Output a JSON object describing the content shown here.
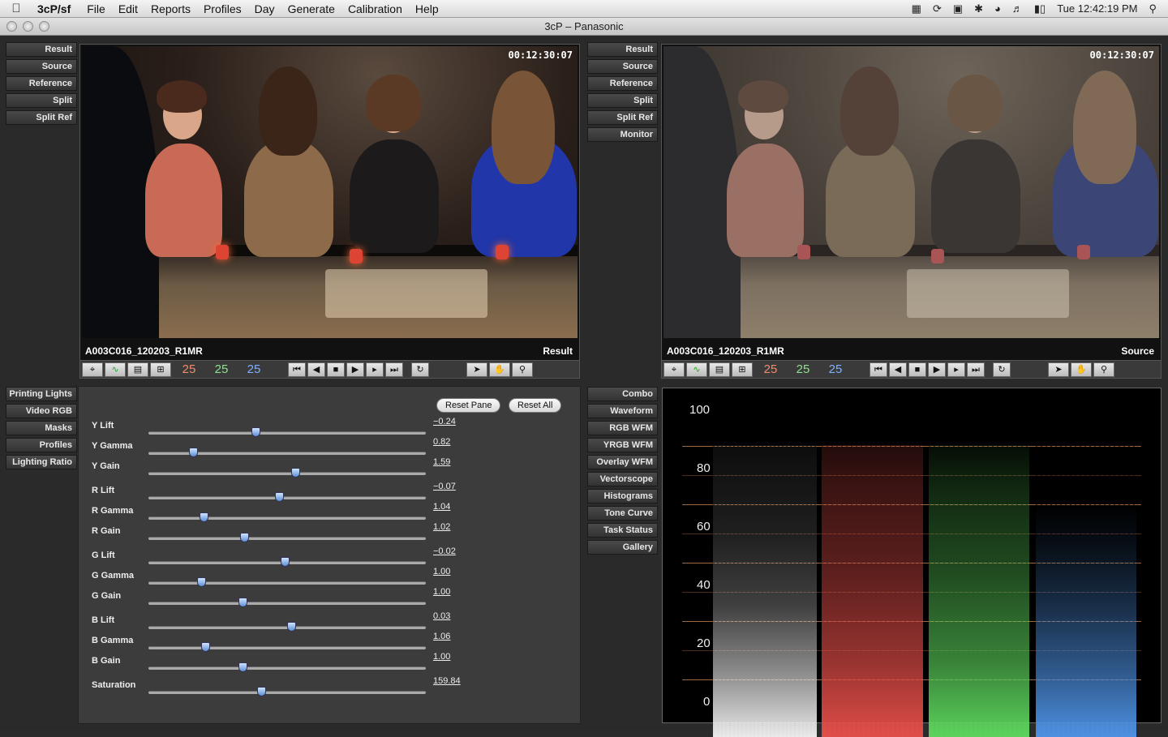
{
  "menubar": {
    "apple": "",
    "app_name": "3cP/sf",
    "items": [
      "File",
      "Edit",
      "Reports",
      "Profiles",
      "Day",
      "Generate",
      "Calibration",
      "Help"
    ],
    "clock": "Tue 12:42:19 PM",
    "icons": [
      "grid-icon",
      "sync-icon",
      "spaces-icon",
      "bluetooth-icon",
      "wifi-icon",
      "volume-icon",
      "battery-icon",
      "spotlight-icon"
    ]
  },
  "window": {
    "title": "3cP – Panasonic"
  },
  "left_view_buttons": [
    "Result",
    "Source",
    "Reference",
    "Split",
    "Split Ref"
  ],
  "right_view_buttons": [
    "Result",
    "Source",
    "Reference",
    "Split",
    "Split Ref",
    "Monitor"
  ],
  "left_viewer": {
    "timecode": "00:12:30:07",
    "clip": "A003C016_120203_R1MR",
    "mode": "Result"
  },
  "right_viewer": {
    "timecode": "00:12:30:07",
    "clip": "A003C016_120203_R1MR",
    "mode": "Source"
  },
  "toolbar": {
    "fps_r": "25",
    "fps_g": "25",
    "fps_b": "25"
  },
  "panel_tabs": [
    "Printing Lights",
    "Video RGB",
    "Masks",
    "Profiles",
    "Lighting Ratio"
  ],
  "scope_tabs": [
    "Combo",
    "Waveform",
    "RGB WFM",
    "YRGB WFM",
    "Overlay WFM",
    "Vectorscope",
    "Histograms",
    "Tone Curve",
    "Task Status",
    "Gallery"
  ],
  "panel": {
    "reset_pane": "Reset Pane",
    "reset_all": "Reset All",
    "sliders": [
      {
        "label": "Y Lift",
        "value": "−0.24",
        "pos": 0.385
      },
      {
        "label": "Y Gamma",
        "value": "0.82",
        "pos": 0.16
      },
      {
        "label": "Y Gain",
        "value": "1.59",
        "pos": 0.53
      },
      {
        "label": "R Lift",
        "value": "−0.07",
        "pos": 0.47
      },
      {
        "label": "R Gamma",
        "value": "1.04",
        "pos": 0.2
      },
      {
        "label": "R Gain",
        "value": "1.02",
        "pos": 0.345
      },
      {
        "label": "G Lift",
        "value": "−0.02",
        "pos": 0.49
      },
      {
        "label": "G Gamma",
        "value": "1.00",
        "pos": 0.19
      },
      {
        "label": "G Gain",
        "value": "1.00",
        "pos": 0.34
      },
      {
        "label": "B Lift",
        "value": "0.03",
        "pos": 0.515
      },
      {
        "label": "B Gamma",
        "value": "1.06",
        "pos": 0.205
      },
      {
        "label": "B Gain",
        "value": "1.00",
        "pos": 0.34
      },
      {
        "label": "Saturation",
        "value": "159.84",
        "pos": 0.405
      }
    ]
  },
  "scope": {
    "axis": [
      "100",
      "80",
      "60",
      "40",
      "20",
      "0"
    ]
  }
}
